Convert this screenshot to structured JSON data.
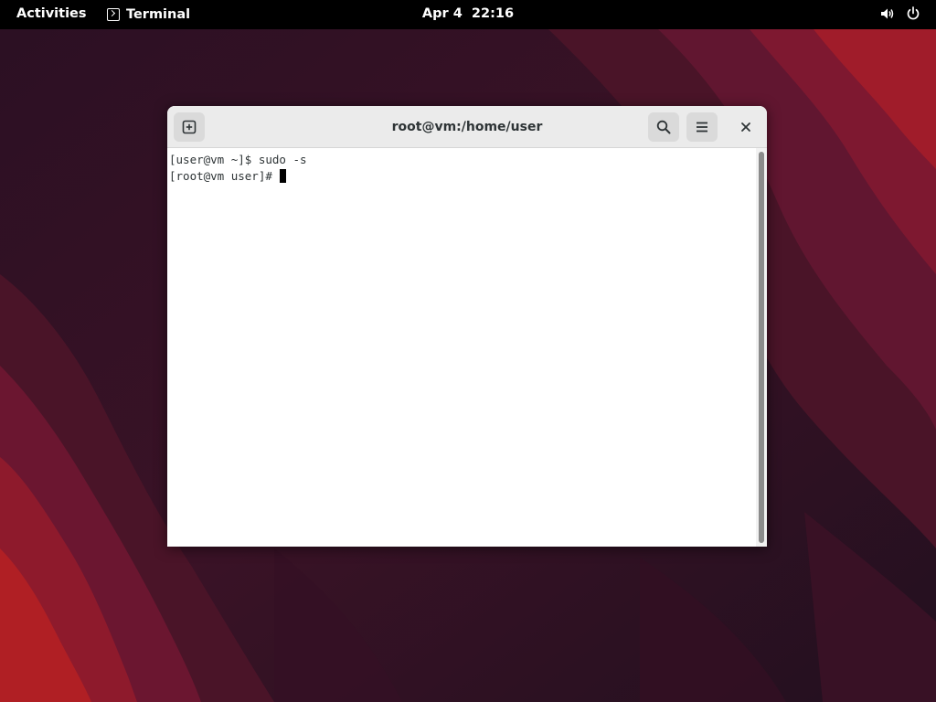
{
  "topbar": {
    "activities_label": "Activities",
    "app_name": "Terminal",
    "app_icon": "terminal-icon",
    "clock": "Apr 4  22:16",
    "tray_icons": [
      "volume-icon",
      "power-icon"
    ]
  },
  "window": {
    "title": "root@vm:/home/user",
    "buttons": {
      "new_tab_icon": "new-tab-icon",
      "search_icon": "search-icon",
      "menu_icon": "hamburger-menu-icon",
      "close_icon": "close-icon"
    },
    "lines": [
      "[user@vm ~]$ sudo -s",
      "[root@vm user]# "
    ]
  },
  "colors": {
    "topbar_bg": "#000000",
    "headerbar_bg": "#ebebeb",
    "terminal_bg": "#ffffff",
    "terminal_fg": "#2e3436",
    "wallpaper_dark": "#2a0f24",
    "wallpaper_red": "#a51c1c"
  }
}
